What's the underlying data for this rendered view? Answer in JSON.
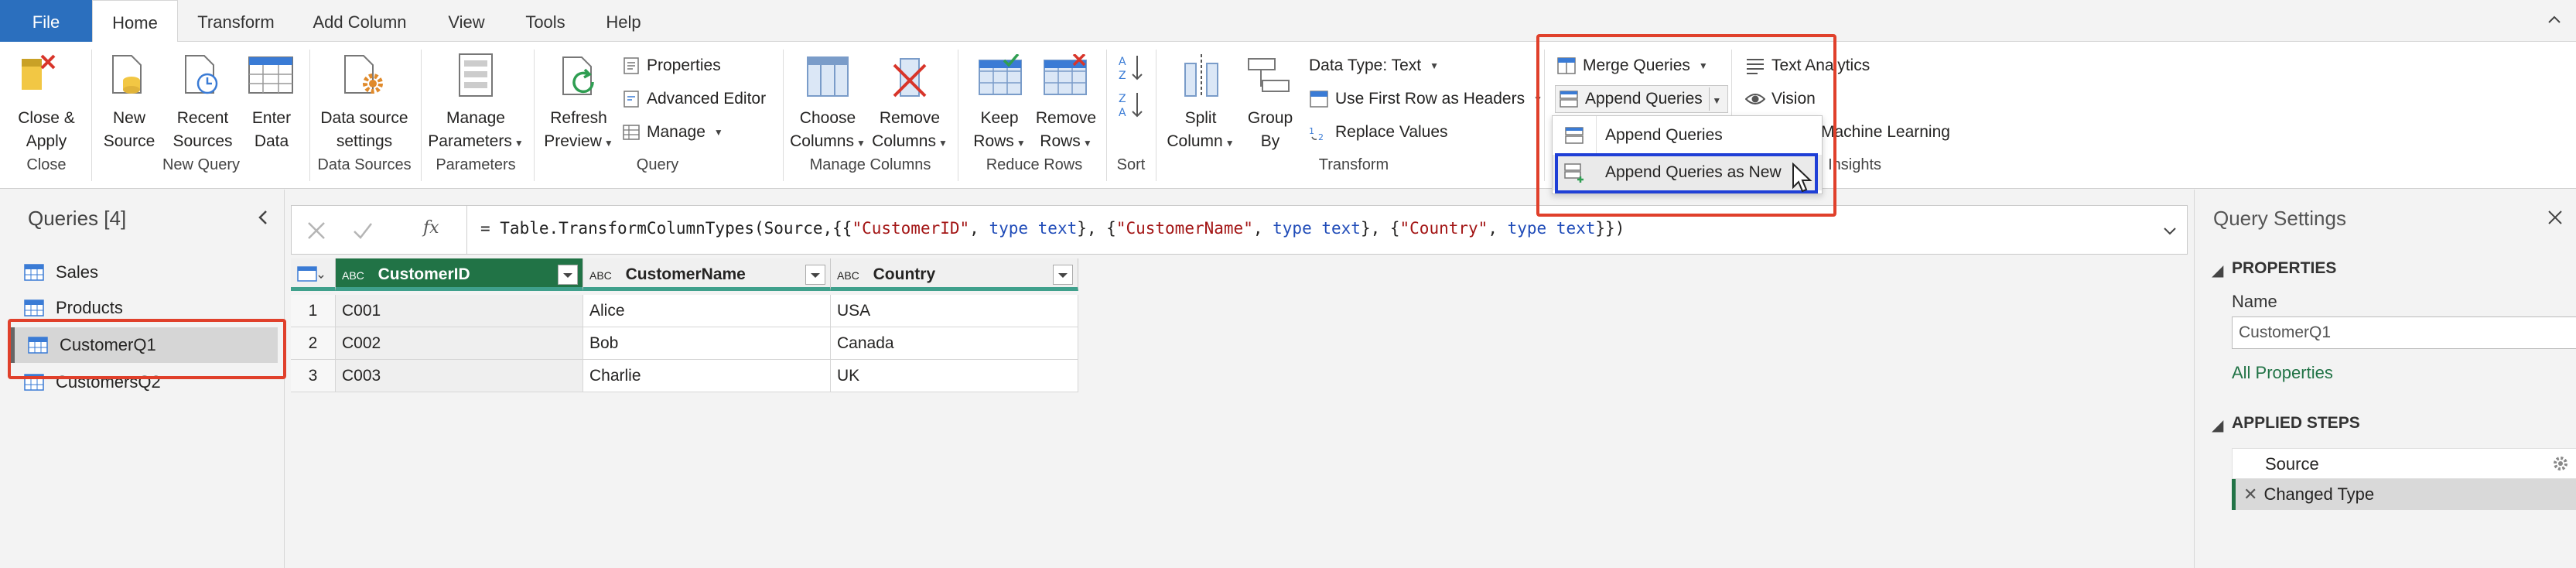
{
  "menu": {
    "tabs": [
      "File",
      "Home",
      "Transform",
      "Add Column",
      "View",
      "Tools",
      "Help"
    ]
  },
  "ribbon": {
    "close": {
      "close_apply": "Close &\nApply",
      "group": "Close"
    },
    "new_query": {
      "new_source": "New\nSource",
      "recent_sources": "Recent\nSources",
      "enter_data": "Enter\nData",
      "group": "New Query"
    },
    "data_sources": {
      "settings": "Data source\nsettings",
      "group": "Data Sources"
    },
    "parameters": {
      "manage": "Manage\nParameters",
      "group": "Parameters"
    },
    "query": {
      "refresh": "Refresh\nPreview",
      "properties": "Properties",
      "advanced_editor": "Advanced Editor",
      "manage": "Manage",
      "group": "Query"
    },
    "manage_columns": {
      "choose": "Choose\nColumns",
      "remove": "Remove\nColumns",
      "group": "Manage Columns"
    },
    "reduce_rows": {
      "keep": "Keep\nRows",
      "remove": "Remove\nRows",
      "group": "Reduce Rows"
    },
    "sort": {
      "group": "Sort"
    },
    "transform": {
      "split": "Split\nColumn",
      "group_by": "Group\nBy",
      "data_type": "Data Type: Text",
      "first_row": "Use First Row as Headers",
      "replace": "Replace Values",
      "group": "Transform"
    },
    "combine": {
      "merge": "Merge Queries",
      "append": "Append Queries"
    },
    "ai": {
      "text_analytics": "Text Analytics",
      "vision": "Vision",
      "ml": "Machine Learning",
      "group_partial": "I Insights"
    }
  },
  "dropdown": {
    "items": [
      "Append Queries",
      "Append Queries as New"
    ]
  },
  "queries": {
    "title": "Queries [4]",
    "items": [
      "Sales",
      "Products",
      "CustomerQ1",
      "CustomersQ2"
    ]
  },
  "formula": {
    "prefix": "= Table.TransformColumnTypes(Source,{{",
    "parts": [
      "\"CustomerID\"",
      ", ",
      "type text",
      "}, {",
      "\"CustomerName\"",
      ", ",
      "type text",
      "}, {",
      "\"Country\"",
      ", ",
      "type text",
      "}})"
    ]
  },
  "table": {
    "type_label": "ABC",
    "columns": [
      "CustomerID",
      "CustomerName",
      "Country"
    ],
    "rows": [
      [
        "1",
        "C001",
        "Alice",
        "USA"
      ],
      [
        "2",
        "C002",
        "Bob",
        "Canada"
      ],
      [
        "3",
        "C003",
        "Charlie",
        "UK"
      ]
    ]
  },
  "settings": {
    "title": "Query Settings",
    "properties_heading": "PROPERTIES",
    "name_label": "Name",
    "name_value": "CustomerQ1",
    "all_properties": "All Properties",
    "steps_heading": "APPLIED STEPS",
    "steps": [
      "Source",
      "Changed Type"
    ]
  },
  "colors": {
    "file_blue": "#2b6fbe",
    "accent_green": "#3fa08c",
    "highlight_red": "#e0402b",
    "highlight_blue": "#1f3fd6",
    "link_green": "#217346"
  }
}
